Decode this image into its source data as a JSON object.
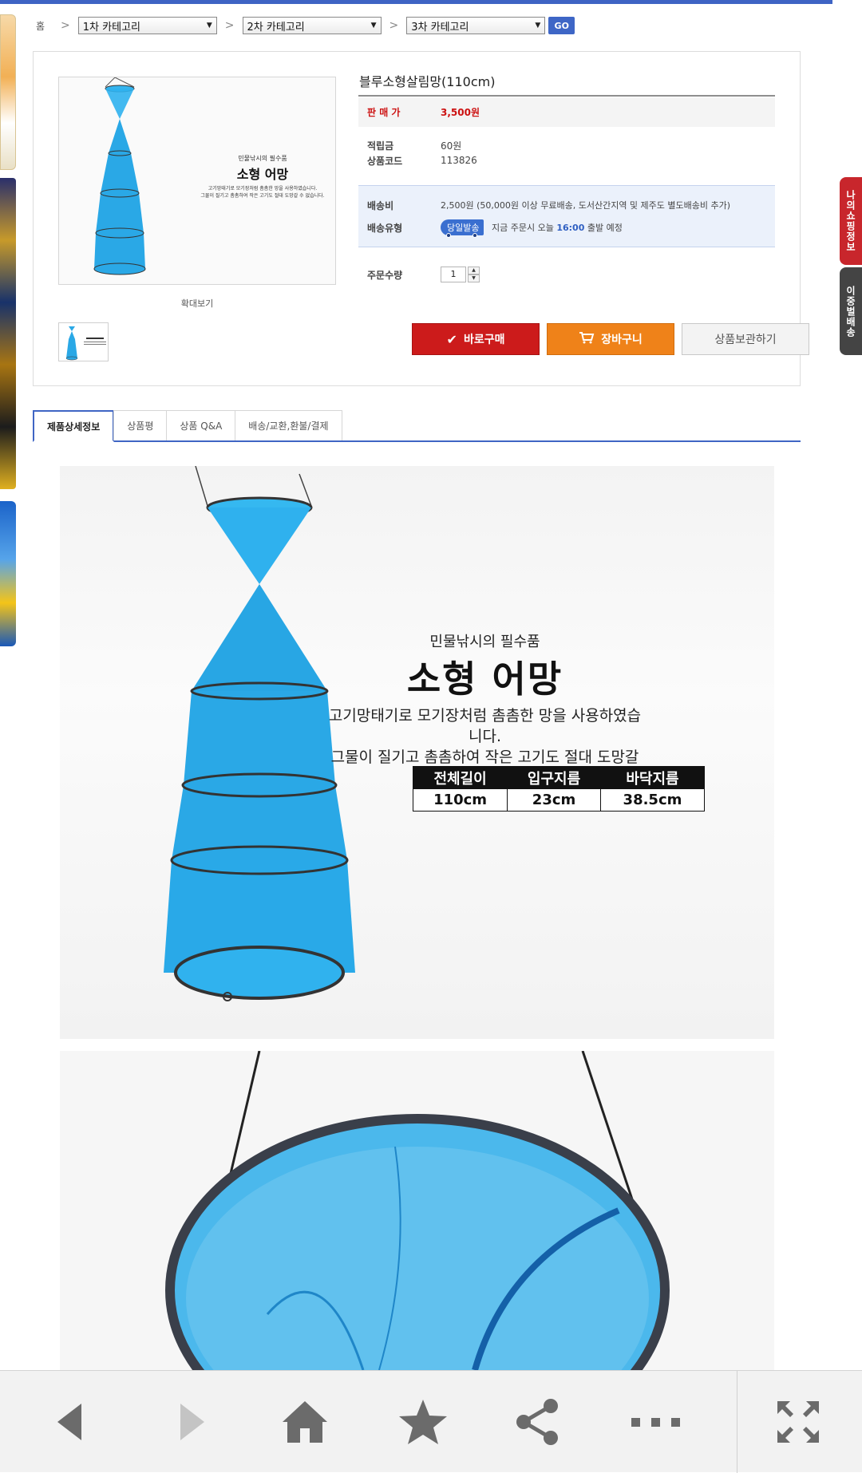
{
  "breadcrumb": {
    "home": "홈",
    "sep": ">",
    "cat1": "1차 카테고리",
    "cat2": "2차 카테고리",
    "cat3": "3차 카테고리",
    "go": "GO"
  },
  "side_tabs": {
    "recent": "나의쇼핑정보",
    "fishing": "이중벌배송"
  },
  "product": {
    "title": "블루소형살림망(110cm)",
    "zoom_label": "확대보기",
    "price_label": "판 매 가",
    "price": "3,500원",
    "points_label": "적립금",
    "points": "60원",
    "code_label": "상품코드",
    "code": "113826",
    "ship_fee_label": "배송비",
    "ship_fee": "2,500원 (50,000원 이상 무료배송, 도서산간지역 및 제주도 별도배송비 추가)",
    "ship_type_label": "배송유형",
    "ship_badge": "당일발송",
    "ship_note_pre": "지금 주문시 오늘",
    "ship_time": "16:00",
    "ship_note_post": "출발 예정",
    "qty_label": "주문수량",
    "qty": "1",
    "buy_label": "바로구매",
    "cart_label": "장바구니",
    "keep_label": "상품보관하기"
  },
  "tabs": [
    "제품상세정보",
    "상품평",
    "상품 Q&A",
    "배송/교환,환불/결제"
  ],
  "detail": {
    "sub": "민물낚시의 필수품",
    "title": "소형 어망",
    "desc1": "고기망태기로 모기장처럼 촘촘한 망을 사용하였습니다.",
    "desc2": "그물이 질기고 촘촘하여 작은 고기도 절대 도망갈 수 없습니다.",
    "spec_headers": [
      "전체길이",
      "입구지름",
      "바닥지름"
    ],
    "spec_values": [
      "110cm",
      "23cm",
      "38.5cm"
    ]
  },
  "colors": {
    "accent": "#3e64c4",
    "price": "#cc1111",
    "buy": "#cc1b1b",
    "cart": "#ef8219",
    "net": "#2aa8e6"
  },
  "icons": [
    "back-icon",
    "forward-icon",
    "home-icon",
    "star-icon",
    "share-icon",
    "more-icon",
    "fullscreen-icon"
  ]
}
